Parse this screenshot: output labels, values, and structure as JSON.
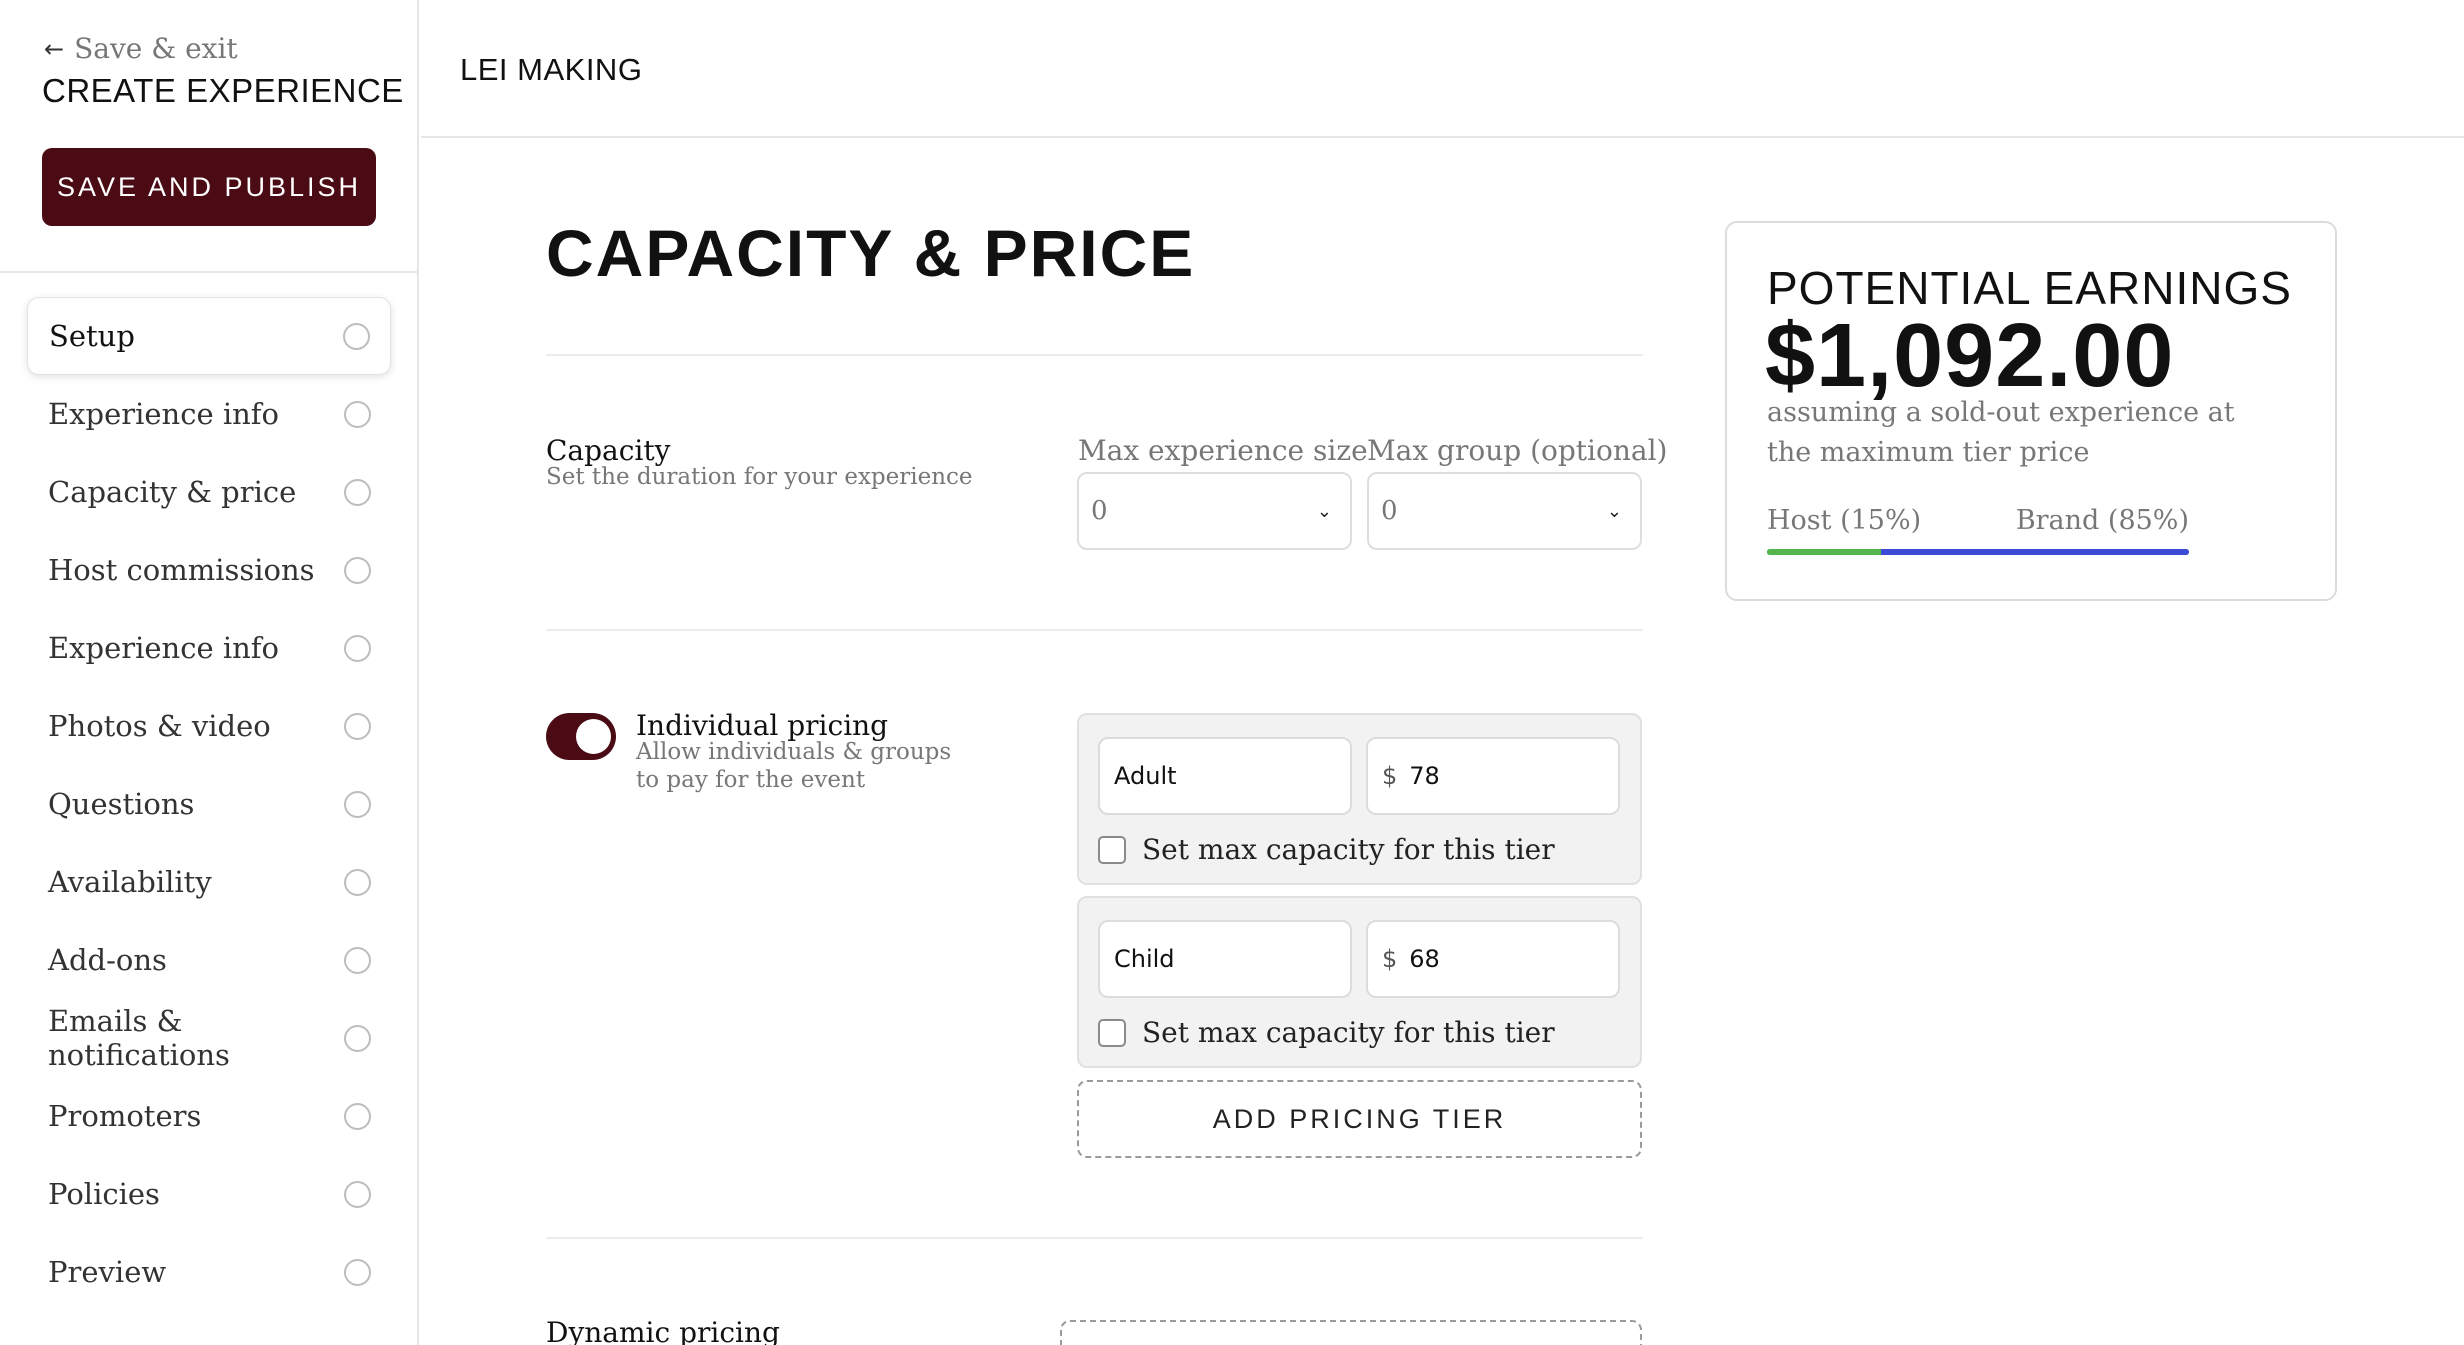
{
  "sidebar": {
    "back_label": "Save & exit",
    "title": "CREATE EXPERIENCE",
    "publish_label": "SAVE AND PUBLISH",
    "items": [
      {
        "label": "Setup",
        "active": true
      },
      {
        "label": "Experience info"
      },
      {
        "label": "Capacity & price"
      },
      {
        "label": "Host commissions"
      },
      {
        "label": "Experience info"
      },
      {
        "label": "Photos & video"
      },
      {
        "label": "Questions"
      },
      {
        "label": "Availability"
      },
      {
        "label": "Add-ons"
      },
      {
        "label": "Emails & notifications"
      },
      {
        "label": "Promoters"
      },
      {
        "label": "Policies"
      },
      {
        "label": "Preview"
      }
    ]
  },
  "header": {
    "event_name": "LEI MAKING"
  },
  "main": {
    "title": "CAPACITY & PRICE",
    "capacity": {
      "label": "Capacity",
      "sub": "Set the duration for your experience",
      "max_size_label": "Max experience size",
      "max_size_value": "0",
      "max_group_label": "Max group (optional)",
      "max_group_value": "0"
    },
    "individual_pricing": {
      "label": "Individual pricing",
      "sub": "Allow individuals & groups to pay for the event",
      "enabled": true,
      "currency": "$",
      "tiers": [
        {
          "name": "Adult",
          "price": "78",
          "checkbox_label": "Set max capacity for this tier"
        },
        {
          "name": "Child",
          "price": "68",
          "checkbox_label": "Set max capacity for this tier"
        }
      ],
      "add_tier_label": "ADD PRICING TIER"
    },
    "dynamic_pricing": {
      "label": "Dynamic pricing"
    }
  },
  "earnings": {
    "title": "POTENTIAL EARNINGS",
    "amount": "$1,092.00",
    "sub": "assuming a sold-out experience at the maximum tier price",
    "host_label": "Host (15%)",
    "brand_label": "Brand (85%)",
    "host_fraction": 0.27,
    "host_color": "#52b64a",
    "brand_color": "#3c4ad6"
  },
  "colors": {
    "accent": "#4a0b14"
  }
}
